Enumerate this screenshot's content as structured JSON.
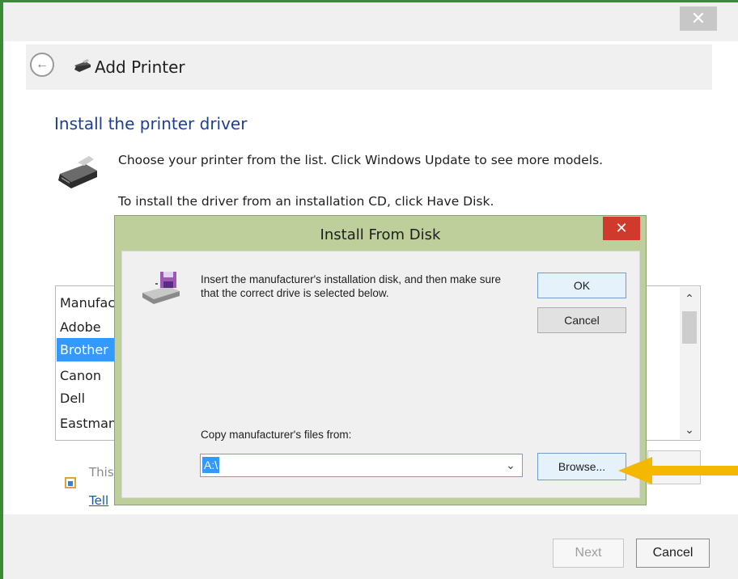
{
  "wizard": {
    "title": "Add Printer",
    "close_glyph": "✕",
    "back_glyph": "←",
    "heading": "Install the printer driver",
    "instruction_1": "Choose your printer from the list. Click Windows Update to see more models.",
    "instruction_2": "To install the driver from an installation CD, click Have Disk.",
    "manufacturer_list": {
      "header": "Manufac",
      "items": [
        "Adobe",
        "Brother",
        "Canon",
        "Dell",
        "Eastman"
      ],
      "selected": "Brother"
    },
    "signed_text": "This",
    "tell_link": "Tell",
    "next_button": "Next",
    "cancel_button": "Cancel"
  },
  "dialog": {
    "title": "Install From Disk",
    "close_glyph": "✕",
    "message": "Insert the manufacturer's installation disk, and then make sure that the correct drive is selected below.",
    "ok_button": "OK",
    "cancel_button": "Cancel",
    "copy_label": "Copy manufacturer's files from:",
    "path_value": "A:\\",
    "browse_button": "Browse..."
  },
  "icons": {
    "printer": "printer-icon",
    "disk": "floppy-disk-drive-icon",
    "shield": "shield-icon",
    "arrow": "arrow-left-icon"
  },
  "colors": {
    "accent_green": "#3a8a3a",
    "heading_blue": "#1e3f94",
    "selection_blue": "#3399ff",
    "dialog_frame": "#bfcf9b",
    "close_red": "#cf3a2c",
    "arrow_yellow": "#f5b800"
  }
}
